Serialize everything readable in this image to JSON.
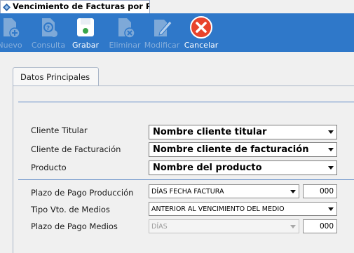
{
  "window": {
    "title": "Vencimiento de Facturas por Pro..."
  },
  "toolbar": {
    "buttons": [
      {
        "label": "Nuevo",
        "icon": "new-document-icon",
        "enabled": false
      },
      {
        "label": "Consulta",
        "icon": "query-document-icon",
        "enabled": false
      },
      {
        "label": "Grabar",
        "icon": "save-icon",
        "enabled": true
      },
      {
        "label": "Eliminar",
        "icon": "delete-document-icon",
        "enabled": false
      },
      {
        "label": "Modificar",
        "icon": "edit-pencil-icon",
        "enabled": false
      },
      {
        "label": "Cancelar",
        "icon": "cancel-icon",
        "enabled": true
      }
    ],
    "colors": {
      "background": "#2f78c9",
      "cancel": "#e8432c"
    }
  },
  "main": {
    "tab_label": "Datos Principales",
    "fields": {
      "cliente_titular": {
        "label": "Cliente Titular",
        "value": "Nombre cliente titular"
      },
      "cliente_facturacion": {
        "label": "Cliente de Facturación",
        "value": "Nombre cliente de facturación"
      },
      "producto": {
        "label": "Producto",
        "value": "Nombre del producto"
      },
      "plazo_pago_produccion": {
        "label": "Plazo de Pago Producción",
        "value": "DÍAS FECHA FACTURA",
        "days": "000"
      },
      "tipo_vto_medios": {
        "label": "Tipo Vto. de Medios",
        "value": "ANTERIOR AL VENCIMIENTO DEL MEDIO"
      },
      "plazo_pago_medios": {
        "label": "Plazo de Pago Medios",
        "value": "DÍAS",
        "days": "000",
        "enabled": false
      }
    }
  }
}
